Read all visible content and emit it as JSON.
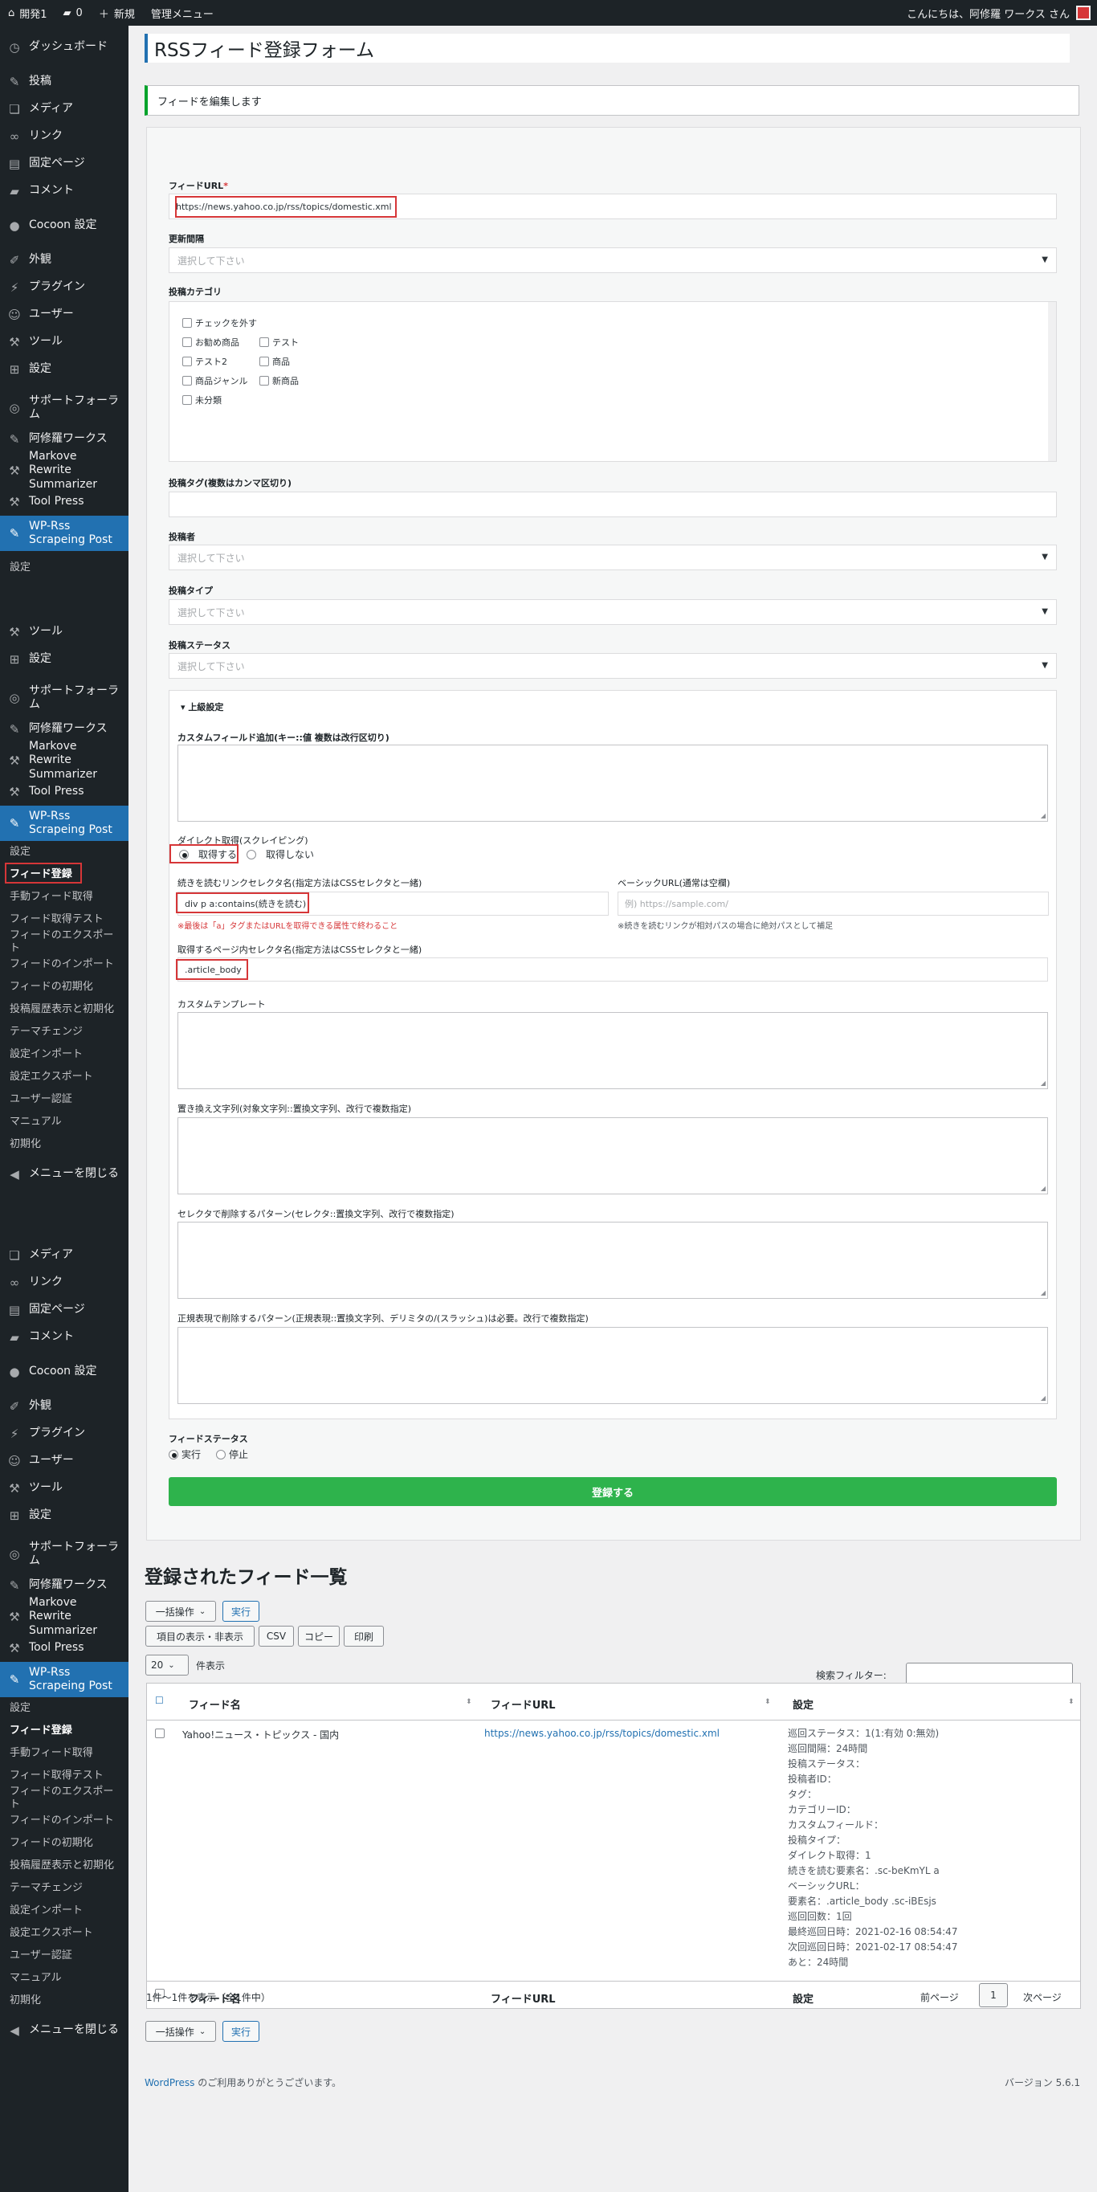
{
  "adminbar": {
    "site_name": "開発1",
    "comments_count": "0",
    "new_label": "新規",
    "admin_menu_label": "管理メニュー",
    "greeting": "こんにちは、阿修羅 ワークス さん"
  },
  "sidebar": {
    "main_items": [
      "ダッシュボード",
      "投稿",
      "メディア",
      "リンク",
      "固定ページ",
      "コメント",
      "Cocoon 設定",
      "外観",
      "プラグイン",
      "ユーザー",
      "ツール",
      "設定",
      "サポートフォーラム",
      "阿修羅ワークス",
      "Markove Rewrite Summarizer",
      "Tool Press",
      "WP-Rss Scrapeing Post"
    ],
    "mid_items": [
      "ツール",
      "設定",
      "サポートフォーラム",
      "阿修羅ワークス",
      "Markove Rewrite Summarizer",
      "Tool Press",
      "WP-Rss Scrapeing Post"
    ],
    "bottom_items": [
      "メディア",
      "リンク",
      "固定ページ",
      "コメント",
      "Cocoon 設定",
      "外観",
      "プラグイン",
      "ユーザー",
      "ツール",
      "設定",
      "サポートフォーラム",
      "阿修羅ワークス",
      "Markove Rewrite Summarizer",
      "Tool Press",
      "WP-Rss Scrapeing Post"
    ],
    "sub_first": "設定",
    "sub_items": [
      "設定",
      "フィード登録",
      "手動フィード取得",
      "フィード取得テスト",
      "フィードのエクスポート",
      "フィードのインポート",
      "フィードの初期化",
      "投稿履歴表示と初期化",
      "テーマチェンジ",
      "設定インポート",
      "設定エクスポート",
      "ユーザー認証",
      "マニュアル",
      "初期化"
    ],
    "collapse_label": "メニューを閉じる"
  },
  "page": {
    "title": "RSSフィード登録フォーム",
    "notice": "フィードを編集します"
  },
  "form": {
    "feed_url_label": "フィードURL",
    "required_mark": "*",
    "feed_url_value": "https://news.yahoo.co.jp/rss/topics/domestic.xml",
    "interval_label": "更新間隔",
    "select_placeholder": "選択して下さい",
    "category_label": "投稿カテゴリ",
    "categories": [
      "チェックを外す",
      "お勧め商品",
      "テスト",
      "テスト2",
      "商品",
      "商品ジャンル",
      "新商品",
      "未分類"
    ],
    "tags_label": "投稿タグ(複数はカンマ区切り)",
    "author_label": "投稿者",
    "type_label": "投稿タイプ",
    "status_label": "投稿ステータス",
    "advanced_label": "上級設定",
    "custom_field_label": "カスタムフィールド追加(キー::値 複数は改行区切り)",
    "direct_label": "ダイレクト取得(スクレイピング)",
    "direct_yes": "取得する",
    "direct_no": "取得しない",
    "more_selector_label": "続きを読むリンクセレクタ名(指定方法はCSSセレクタと一緒)",
    "more_selector_value": "div p a:contains(続きを読む)",
    "more_selector_hint": "※最後は「a」タグまたはURLを取得できる属性で終わること",
    "base_url_label": "ベーシックURL(通常は空欄)",
    "base_url_placeholder": "例) https://sample.com/",
    "base_url_hint": "※続きを読むリンクが相対パスの場合に絶対パスとして補足",
    "content_selector_label": "取得するページ内セレクタ名(指定方法はCSSセレクタと一緒)",
    "content_selector_value": ".article_body",
    "template_label": "カスタムテンプレート",
    "replace_label": "置き換え文字列(対象文字列::置換文字列、改行で複数指定)",
    "selector_remove_label": "セレクタで削除するパターン(セレクタ::置換文字列、改行で複数指定)",
    "regex_remove_label": "正規表現で削除するパターン(正規表現::置換文字列、デリミタの/(スラッシュ)は必要。改行で複数指定)",
    "feed_status_label": "フィードステータス",
    "status_run": "実行",
    "status_stop": "停止",
    "submit_label": "登録する"
  },
  "list": {
    "title": "登録されたフィード一覧",
    "bulk_label": "一括操作",
    "apply_label": "実行",
    "columns_toggle": "項目の表示・非表示",
    "csv": "CSV",
    "copy": "コピー",
    "print": "印刷",
    "per_page": "20",
    "per_page_suffix": "件表示",
    "search_label": "検索フィルター:",
    "headers": [
      "フィード名",
      "フィードURL",
      "設定"
    ],
    "row": {
      "name": "Yahoo!ニュース・トピックス - 国内",
      "url": "https://news.yahoo.co.jp/rss/topics/domestic.xml",
      "settings": [
        "巡回ステータス：1(1:有効 0:無効)",
        "巡回間隔：24時間",
        "投稿ステータス：",
        "投稿者ID：",
        "タグ：",
        "カテゴリーID：",
        "カスタムフィールド：",
        "投稿タイプ：",
        "ダイレクト取得：1",
        "続きを読む要素名：.sc-beKmYL a",
        "ベーシックURL：",
        "要素名：.article_body .sc-iBEsjs",
        "巡回回数：1回",
        "最終巡回日時：2021-02-16 08:54:47",
        "次回巡回日時：2021-02-17 08:54:47",
        "あと：24時間"
      ]
    },
    "info": "1件〜1件を表示（全1件中）",
    "prev": "前ページ",
    "page": "1",
    "next": "次ページ"
  },
  "footer": {
    "wp_link": "WordPress",
    "thanks": " のご利用ありがとうございます。",
    "version": "バージョン 5.6.1"
  },
  "colors": {
    "accent": "#2271b1",
    "submit": "#2eb34c",
    "highlight": "#d63638",
    "sidebar": "#1d2327"
  }
}
